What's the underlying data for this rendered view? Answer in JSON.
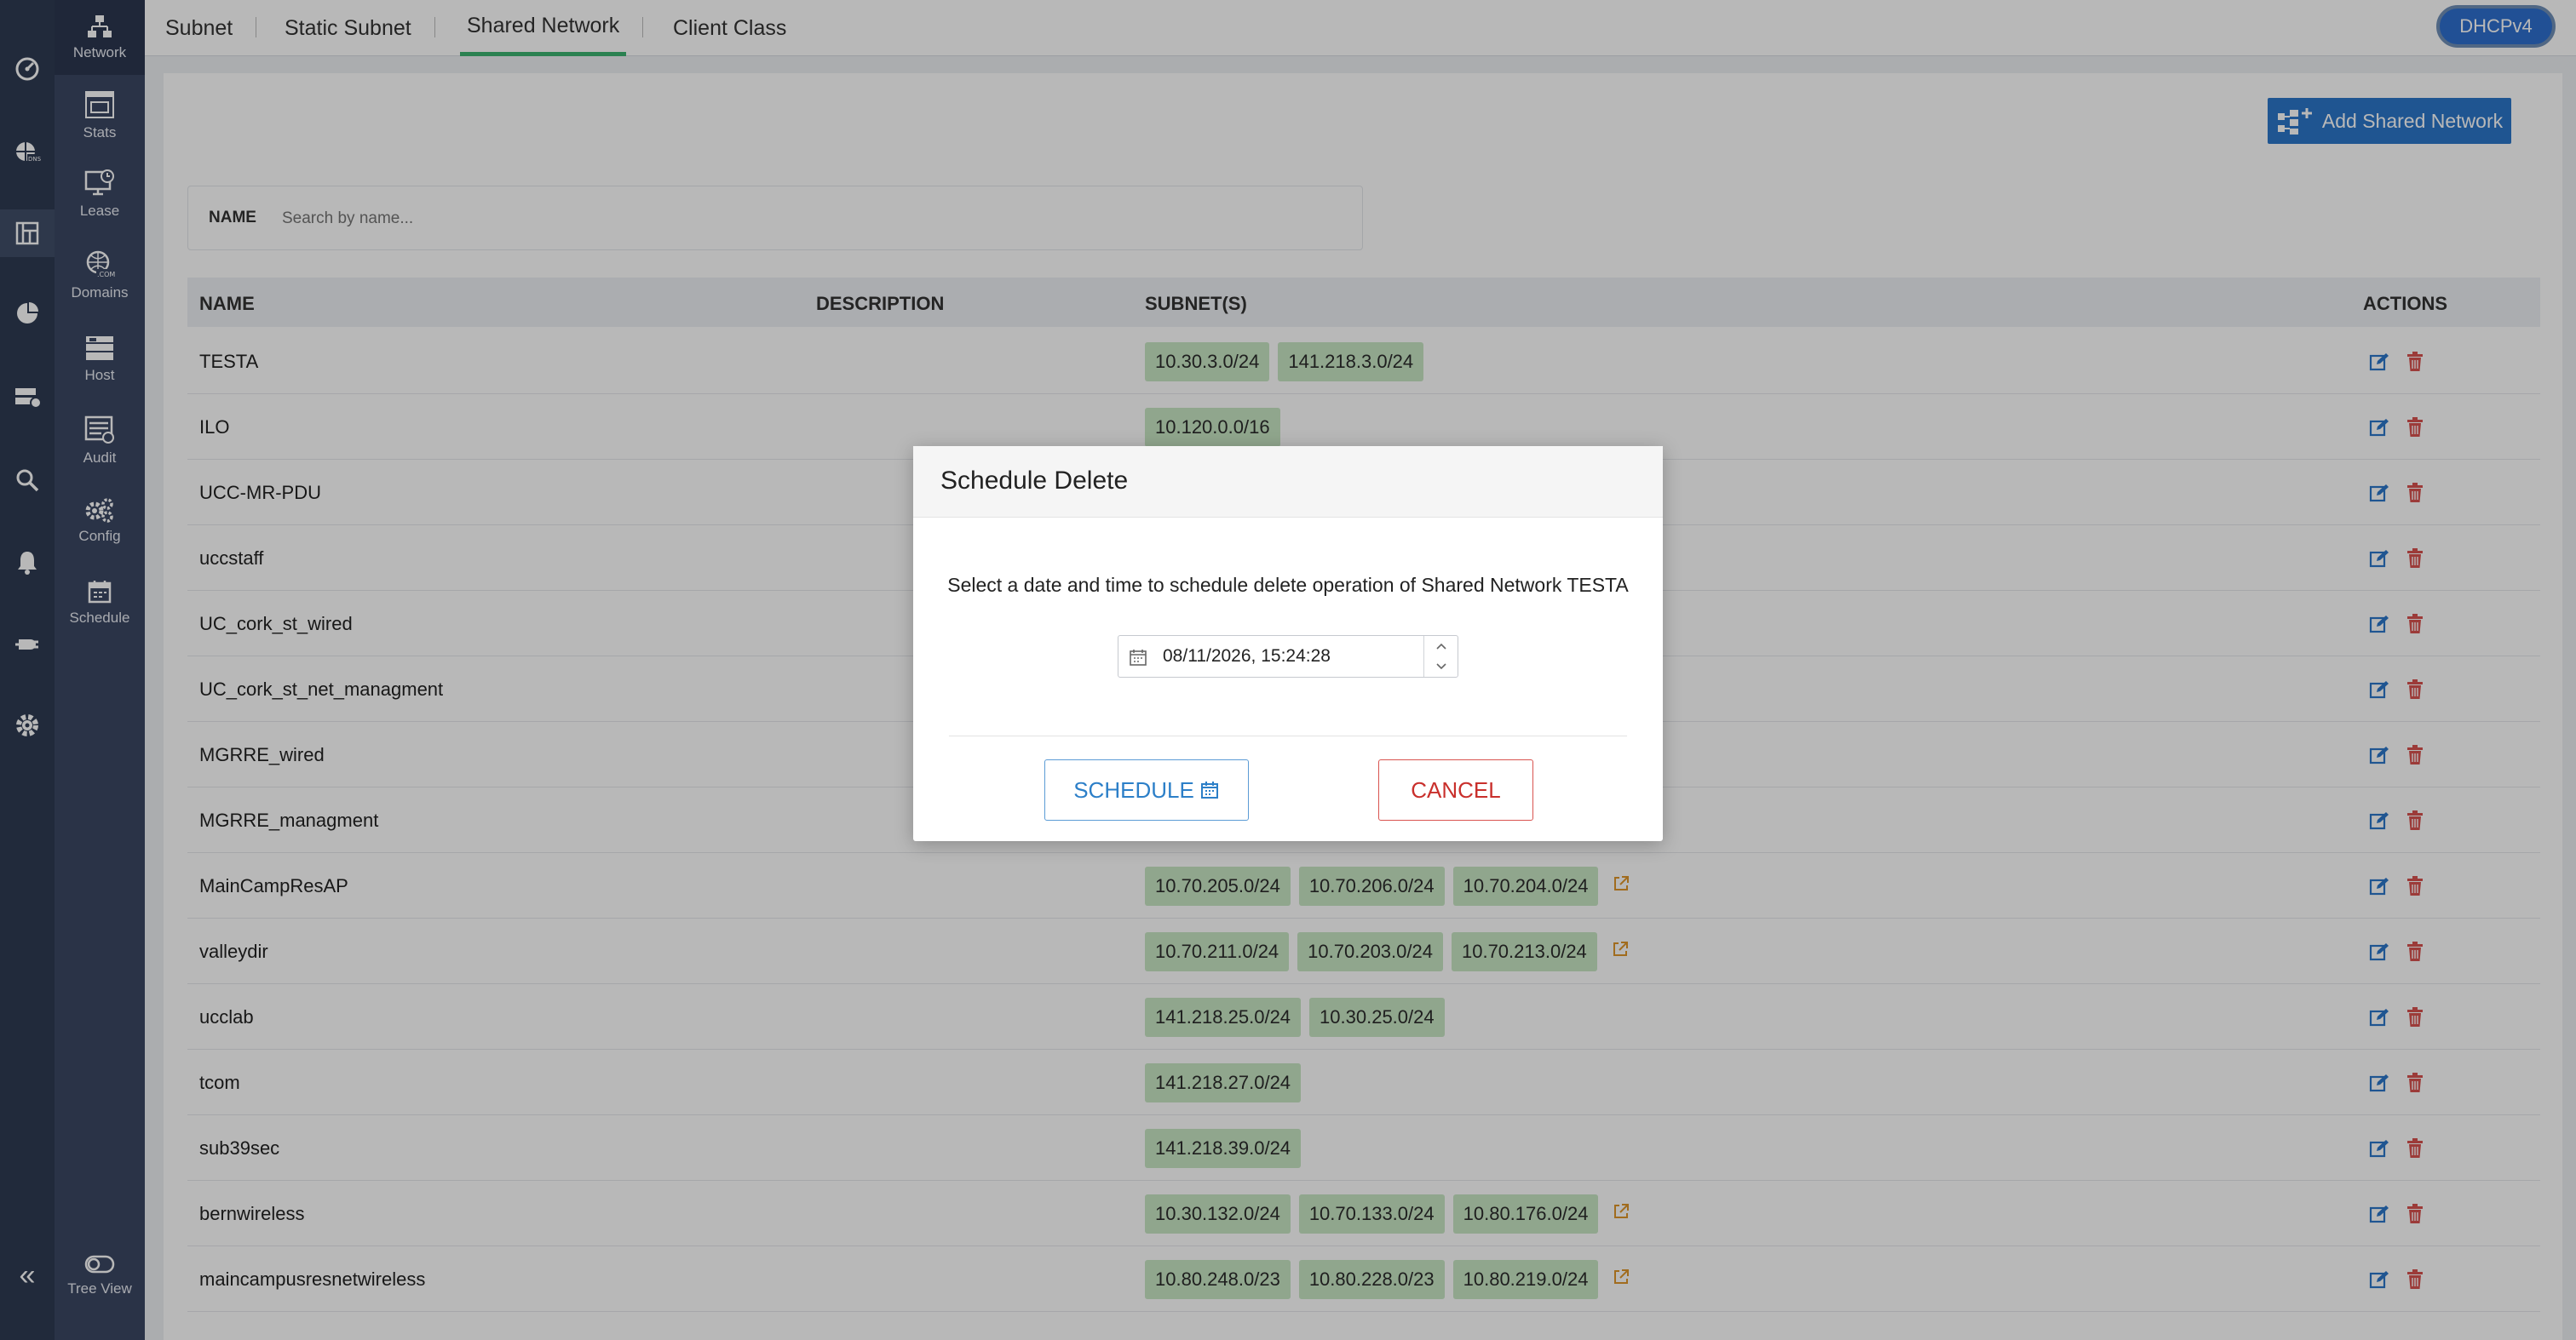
{
  "sidebar": {
    "items": [
      {
        "label": "Network",
        "icon": "network-icon"
      },
      {
        "label": "Stats",
        "icon": "stats-icon"
      },
      {
        "label": "Lease",
        "icon": "lease-icon"
      },
      {
        "label": "Domains",
        "icon": "domains-icon"
      },
      {
        "label": "Host",
        "icon": "host-icon"
      },
      {
        "label": "Audit",
        "icon": "audit-icon"
      },
      {
        "label": "Config",
        "icon": "config-icon"
      },
      {
        "label": "Schedule",
        "icon": "schedule-icon"
      }
    ],
    "bottom": {
      "label": "Tree View",
      "icon": "toggle-icon"
    }
  },
  "rail_icons": [
    "dashboard-icon",
    "dns-icon",
    "dhcp-icon",
    "reports-icon",
    "servers-icon",
    "discovery-icon",
    "alerts-icon",
    "plugin-icon",
    "settings-icon"
  ],
  "tabs": [
    {
      "label": "Subnet"
    },
    {
      "label": "Static Subnet"
    },
    {
      "label": "Shared Network"
    },
    {
      "label": "Client Class"
    }
  ],
  "protocol_toggle": "DHCPv4",
  "add_button": "Add Shared Network",
  "filter": {
    "label": "NAME",
    "placeholder": "Search by name..."
  },
  "table": {
    "headers": {
      "name": "NAME",
      "description": "DESCRIPTION",
      "subnets": "SUBNET(S)",
      "actions": "ACTIONS"
    },
    "rows": [
      {
        "name": "TESTA",
        "subnets": [
          "10.30.3.0/24",
          "141.218.3.0/24"
        ],
        "more": false
      },
      {
        "name": "ILO",
        "subnets": [
          "10.120.0.0/16"
        ],
        "more": false
      },
      {
        "name": "UCC-MR-PDU",
        "subnets": [],
        "more": false
      },
      {
        "name": "uccstaff",
        "subnets": [],
        "more": false
      },
      {
        "name": "UC_cork_st_wired",
        "subnets": [],
        "more": false
      },
      {
        "name": "UC_cork_st_net_managment",
        "subnets": [],
        "more": false
      },
      {
        "name": "MGRRE_wired",
        "subnets": [],
        "more": false
      },
      {
        "name": "MGRRE_managment",
        "subnets": [],
        "more": false
      },
      {
        "name": "MainCampResAP",
        "subnets": [
          "10.70.205.0/24",
          "10.70.206.0/24",
          "10.70.204.0/24"
        ],
        "more": true
      },
      {
        "name": "valleydir",
        "subnets": [
          "10.70.211.0/24",
          "10.70.203.0/24",
          "10.70.213.0/24"
        ],
        "more": true
      },
      {
        "name": "ucclab",
        "subnets": [
          "141.218.25.0/24",
          "10.30.25.0/24"
        ],
        "more": false
      },
      {
        "name": "tcom",
        "subnets": [
          "141.218.27.0/24"
        ],
        "more": false
      },
      {
        "name": "sub39sec",
        "subnets": [
          "141.218.39.0/24"
        ],
        "more": false
      },
      {
        "name": "bernwireless",
        "subnets": [
          "10.30.132.0/24",
          "10.70.133.0/24",
          "10.80.176.0/24"
        ],
        "more": true
      },
      {
        "name": "maincampusresnetwireless",
        "subnets": [
          "10.80.248.0/23",
          "10.80.228.0/23",
          "10.80.219.0/24"
        ],
        "more": true
      }
    ]
  },
  "modal": {
    "title": "Schedule Delete",
    "message": "Select a date and time to schedule delete operation of Shared Network TESTA",
    "datetime": "08/11/2026, 15:24:28",
    "schedule_label": "SCHEDULE",
    "cancel_label": "CANCEL"
  },
  "colors": {
    "accent": "#2c76c9",
    "tab_underline": "#3cb371",
    "chip": "#c8e6c4",
    "delete": "#d9534f"
  }
}
